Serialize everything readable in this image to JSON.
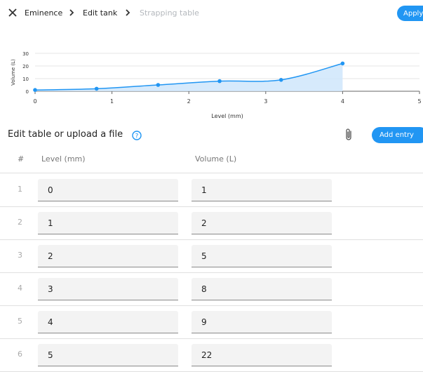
{
  "breadcrumb": {
    "items": [
      {
        "label": "Eminence"
      },
      {
        "label": "Edit tank"
      },
      {
        "label": "Strapping table"
      }
    ]
  },
  "header": {
    "apply_label": "Apply"
  },
  "chart_data": {
    "type": "area",
    "x": [
      0,
      0.8,
      1.6,
      2.4,
      3.2,
      4.0
    ],
    "y": [
      1,
      2,
      5,
      8,
      9,
      22
    ],
    "xlabel": "Level (mm)",
    "ylabel": "Volume (L)",
    "xlim": [
      0,
      5
    ],
    "ylim": [
      0,
      30
    ],
    "xticks": [
      "0",
      "1",
      "2",
      "3",
      "4",
      "5"
    ],
    "yticks": [
      "0",
      "10",
      "20",
      "30"
    ],
    "grid": true,
    "colors": {
      "line": "#2196f3",
      "fill": "#cfe6fb"
    }
  },
  "section": {
    "title": "Edit table or upload a file"
  },
  "actions": {
    "add_entry_label": "Add entry"
  },
  "table": {
    "headers": {
      "index": "#",
      "level": "Level (mm)",
      "volume": "Volume (L)"
    },
    "rows": [
      {
        "n": "1",
        "level": "0",
        "volume": "1"
      },
      {
        "n": "2",
        "level": "1",
        "volume": "2"
      },
      {
        "n": "3",
        "level": "2",
        "volume": "5"
      },
      {
        "n": "4",
        "level": "3",
        "volume": "8"
      },
      {
        "n": "5",
        "level": "4",
        "volume": "9"
      },
      {
        "n": "6",
        "level": "5",
        "volume": "22"
      }
    ]
  },
  "colors": {
    "accent": "#2196f3",
    "muted": "#b4b8bd"
  }
}
